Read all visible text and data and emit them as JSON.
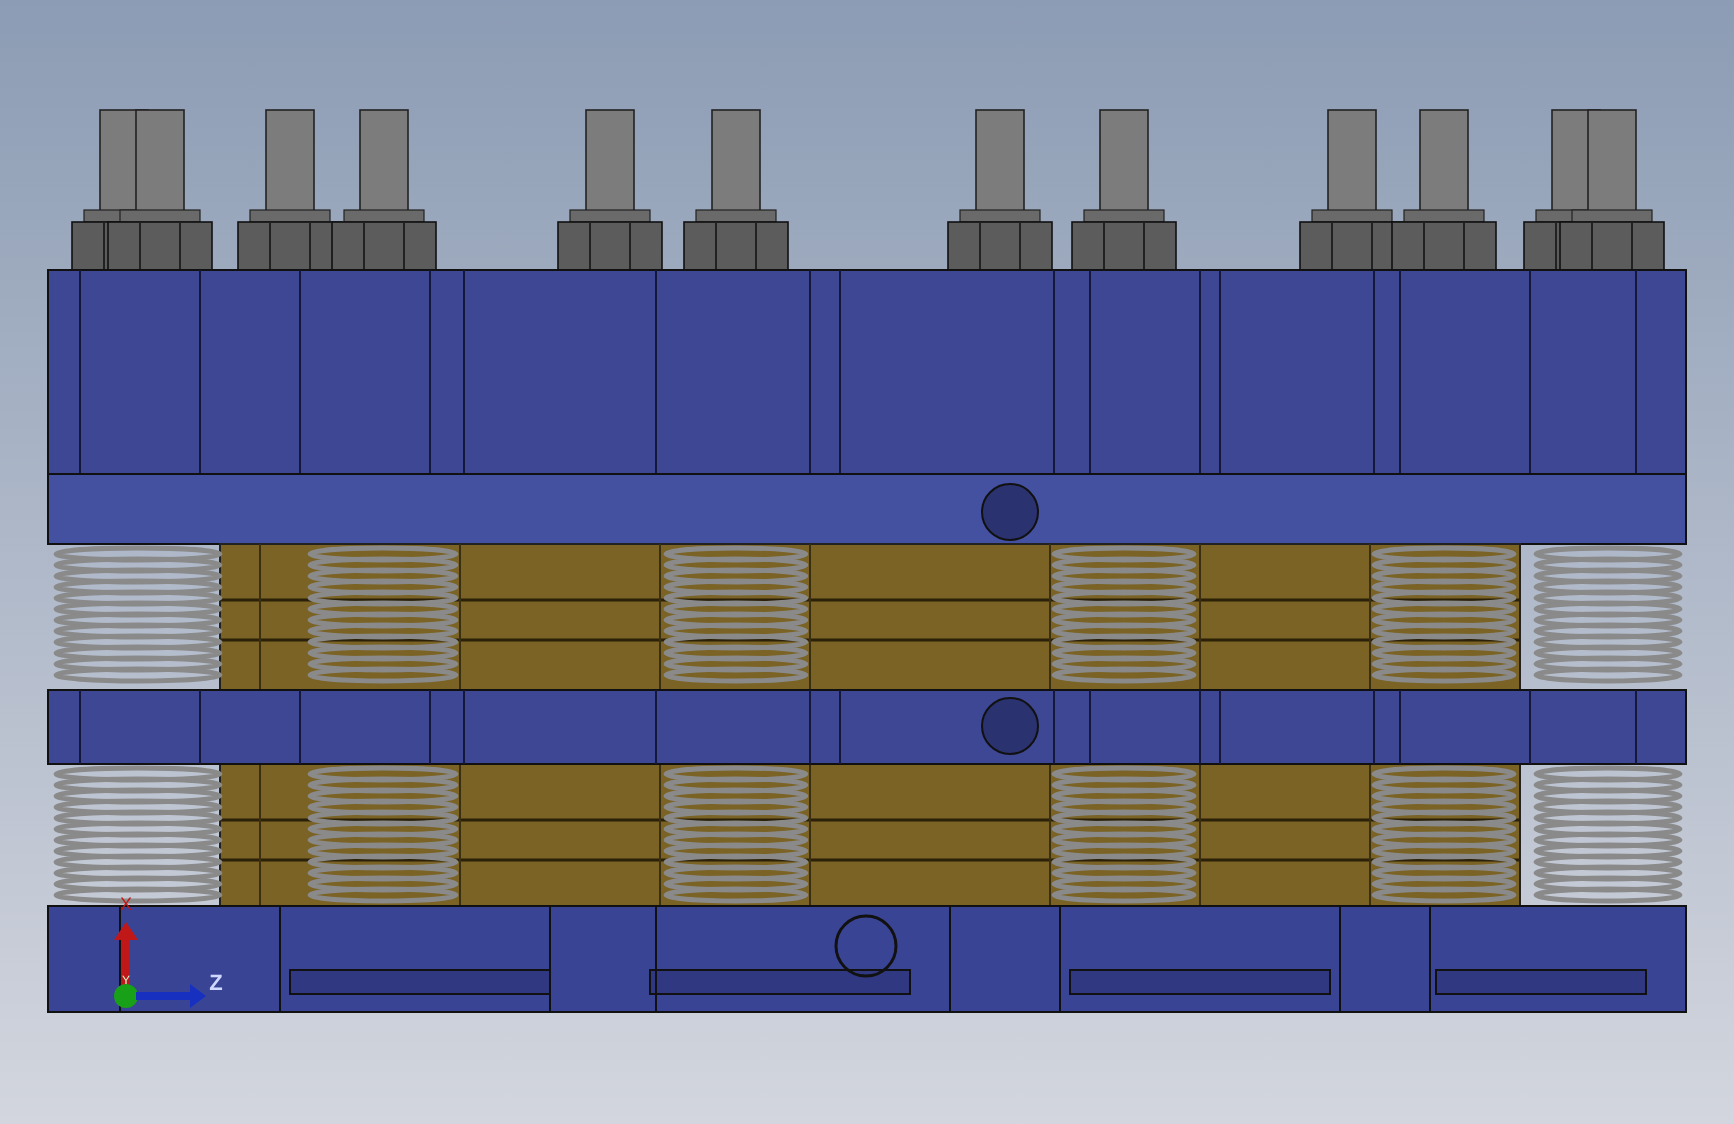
{
  "viewport": {
    "triad": {
      "axes": [
        {
          "label": "X",
          "kind": "vertical",
          "color": "#c01818"
        },
        {
          "label": "Y",
          "kind": "origin",
          "color": "#18a018"
        },
        {
          "label": "Z",
          "kind": "horizontal",
          "color": "#1830c0"
        }
      ]
    }
  }
}
